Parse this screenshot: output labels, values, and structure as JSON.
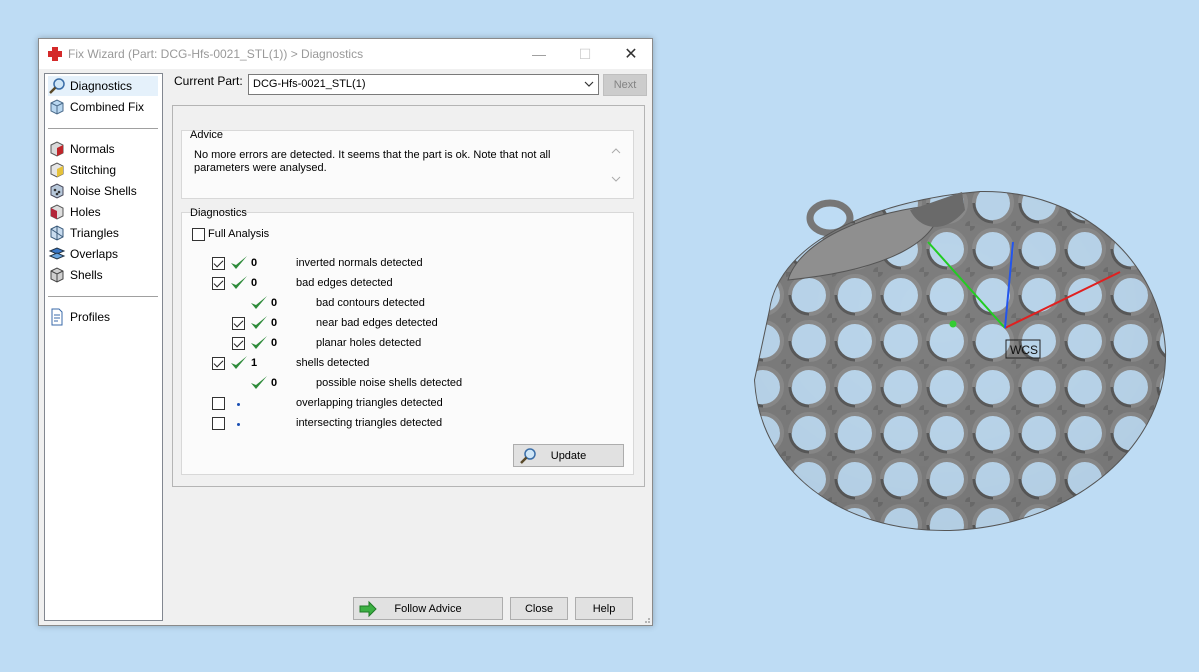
{
  "window": {
    "title": "Fix Wizard (Part: DCG-Hfs-0021_STL(1)) > Diagnostics",
    "minimize_glyph": "—",
    "maximize_glyph": "☐",
    "close_glyph": "✕"
  },
  "sidebar": {
    "items": [
      {
        "label": "Diagnostics",
        "icon": "magnifier-icon"
      },
      {
        "label": "Combined Fix",
        "icon": "cube-icon"
      },
      {
        "label": "Normals",
        "icon": "normals-icon"
      },
      {
        "label": "Stitching",
        "icon": "stitching-icon"
      },
      {
        "label": "Noise Shells",
        "icon": "noise-shells-icon"
      },
      {
        "label": "Holes",
        "icon": "holes-icon"
      },
      {
        "label": "Triangles",
        "icon": "triangles-icon"
      },
      {
        "label": "Overlaps",
        "icon": "overlaps-icon"
      },
      {
        "label": "Shells",
        "icon": "shells-icon"
      },
      {
        "label": "Profiles",
        "icon": "document-icon"
      }
    ]
  },
  "toolbar": {
    "current_part_label": "Current Part:",
    "current_part_value": "DCG-Hfs-0021_STL(1)",
    "next_label": "Next"
  },
  "advice": {
    "title": "Advice",
    "text": "No more errors are detected. It seems that the part is ok. Note that not all parameters were analysed."
  },
  "diagnostics": {
    "title": "Diagnostics",
    "full_analysis_label": "Full Analysis",
    "full_analysis_checked": false,
    "rows": [
      {
        "checked": true,
        "status": "ok",
        "count": "0",
        "label": "inverted normals detected"
      },
      {
        "checked": true,
        "status": "ok",
        "count": "0",
        "label": "bad edges detected"
      },
      {
        "checked": null,
        "status": "ok",
        "count": "0",
        "label": "bad contours detected"
      },
      {
        "checked": true,
        "status": "ok",
        "count": "0",
        "label": "near bad edges detected"
      },
      {
        "checked": true,
        "status": "ok",
        "count": "0",
        "label": "planar holes detected"
      },
      {
        "checked": true,
        "status": "ok",
        "count": "1",
        "label": "shells detected"
      },
      {
        "checked": null,
        "status": "ok",
        "count": "0",
        "label": "possible noise shells detected"
      },
      {
        "checked": false,
        "status": "pending",
        "count": "",
        "label": "overlapping triangles detected"
      },
      {
        "checked": false,
        "status": "pending",
        "count": "",
        "label": "intersecting triangles detected"
      }
    ],
    "update_label": "Update"
  },
  "footer": {
    "follow_advice_label": "Follow Advice",
    "close_label": "Close",
    "help_label": "Help"
  },
  "viewport": {
    "wcs_label": "WCS"
  },
  "colors": {
    "desktop": "#bedcf4",
    "check_green": "#2e8b3a",
    "model_gray": "#7a7a7a"
  }
}
